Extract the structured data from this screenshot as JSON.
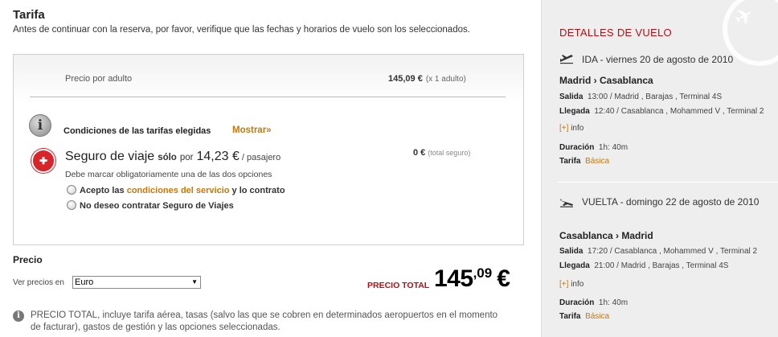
{
  "tarifa": {
    "title": "Tarifa",
    "intro": "Antes de continuar con la reserva, por favor, verifique que las fechas y horarios de vuelo son los seleccionados.",
    "precio_por_adulto_label": "Precio por adulto",
    "precio_por_adulto_value": "145,09 €",
    "precio_por_adulto_count": "(x 1 adulto)",
    "condiciones_label": "Condiciones de las tarifas elegidas",
    "mostrar_label": "Mostrar»"
  },
  "seguro": {
    "name": "Seguro de viaje",
    "solo": "sólo",
    "por": "por",
    "amount": "14,23 €",
    "per_passenger": "/ pasajero",
    "price": "0 €",
    "price_note": "(total seguro)",
    "must_choose": "Debe marcar obligatoriamente una de las dos opciones",
    "option1_prefix": "Acepto las",
    "option1_link": "condiciones del servicio",
    "option1_suffix": "y lo contrato",
    "option2": "No deseo contratar Seguro de Viajes"
  },
  "precio": {
    "label": "Precio",
    "ver_precios_label": "Ver precios en",
    "currency_selected": "Euro",
    "total_label": "PRECIO TOTAL",
    "total_int": "145",
    "total_dec": ",09",
    "total_cur": "€"
  },
  "note": "PRECIO TOTAL, incluye tarifa aérea, tasas (salvo las que se cobren en determinados aeropuertos en el momento de facturar), gastos de gestión y las opciones seleccionadas.",
  "details": {
    "title": "DETALLES DE VUELO",
    "ida": {
      "header": "IDA - viernes 20 de agosto de 2010",
      "route": "Madrid › Casablanca",
      "salida_label": "Salida",
      "salida_value": "13:00 / Madrid , Barajas , Terminal 4S",
      "llegada_label": "Llegada",
      "llegada_value": "12:40 / Casablanca , Mohammed V , Terminal 2",
      "more_plus": "[+]",
      "more_label": "info",
      "duracion_label": "Duración",
      "duracion_value": "1h: 40m",
      "tarifa_label": "Tarifa",
      "tarifa_value": "Básica"
    },
    "vuelta": {
      "header": "VUELTA - domingo 22 de agosto de 2010",
      "route": "Casablanca › Madrid",
      "salida_label": "Salida",
      "salida_value": "17:20 / Casablanca , Mohammed V , Terminal 2",
      "llegada_label": "Llegada",
      "llegada_value": "21:00 / Madrid , Barajas , Terminal 4S",
      "more_plus": "[+]",
      "more_label": "info",
      "duracion_label": "Duración",
      "duracion_value": "1h: 40m",
      "tarifa_label": "Tarifa",
      "tarifa_value": "Básica"
    }
  },
  "colors": {
    "accent_orange": "#c8770a",
    "accent_red": "#b40f14"
  },
  "icons": {
    "info": "info-icon",
    "insurance": "insurance-logo-icon",
    "plane_departure": "plane-departure-icon",
    "plane_arrival": "plane-arrival-icon"
  }
}
